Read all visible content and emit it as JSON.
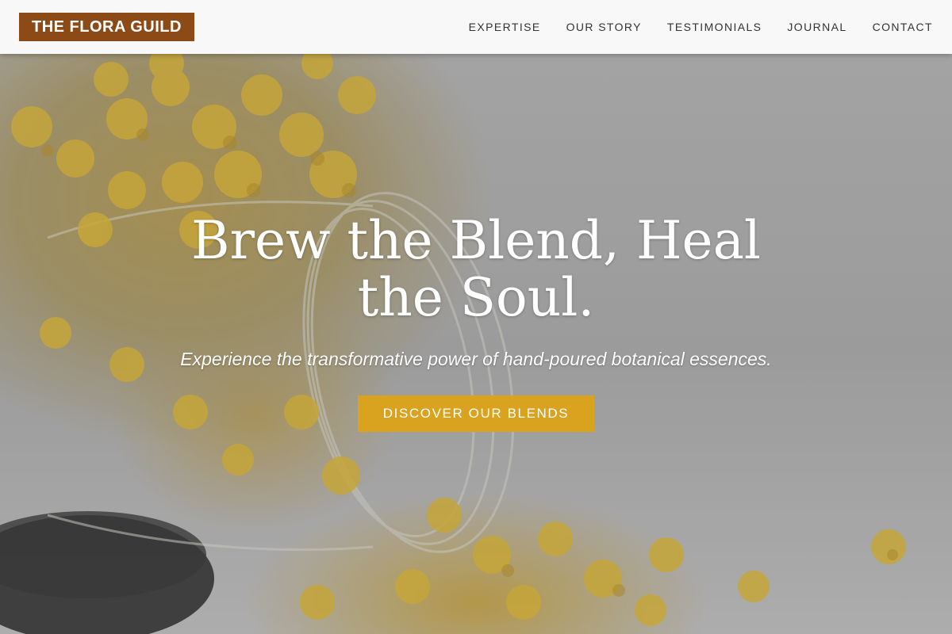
{
  "brand": {
    "logo_text": "THE FLORA GUILD",
    "logo_color": "#8b4a16"
  },
  "nav": {
    "items": [
      {
        "label": "EXPERTISE"
      },
      {
        "label": "OUR STORY"
      },
      {
        "label": "TESTIMONIALS"
      },
      {
        "label": "JOURNAL"
      },
      {
        "label": "CONTACT"
      }
    ]
  },
  "hero": {
    "title": "Brew the Blend, Heal the Soul.",
    "subtitle": "Experience the transformative power of hand-poured botanical essences.",
    "cta_label": "DISCOVER OUR BLENDS",
    "cta_color": "#d9a21f",
    "image_subject": "dried-yellow-flowers-spilling-from-glass-jar"
  }
}
